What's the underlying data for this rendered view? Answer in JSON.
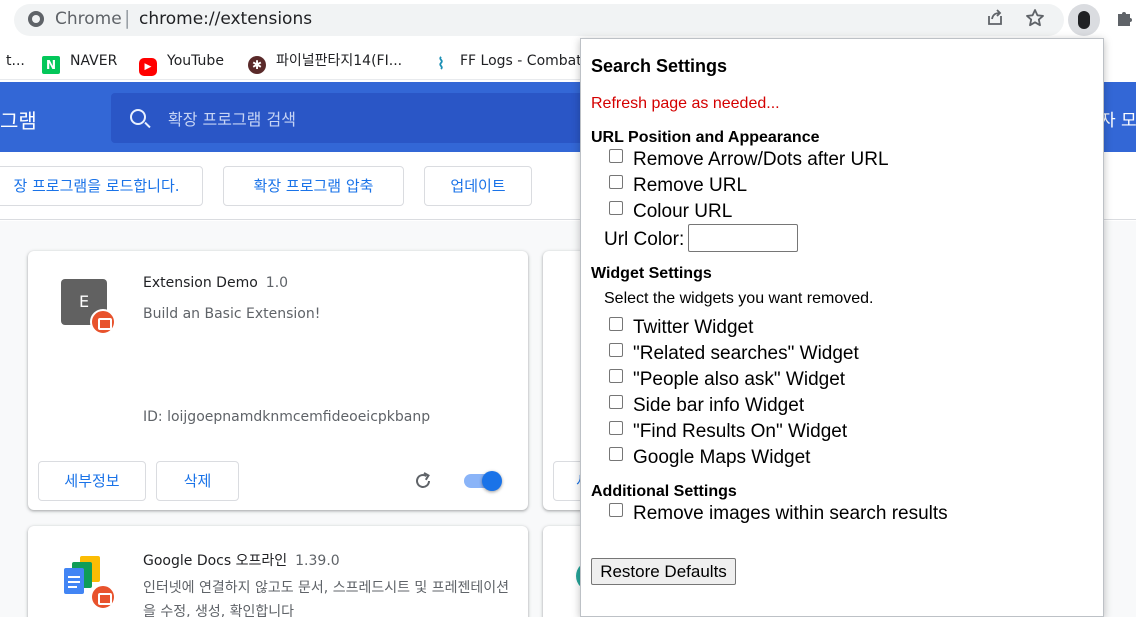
{
  "omnibox": {
    "site_label": "Chrome",
    "separator": "|",
    "url": "chrome://extensions"
  },
  "toolbar_icons": [
    "share-icon",
    "star-icon",
    "profile-icon",
    "puzzle-icon"
  ],
  "bookmarks": [
    {
      "label": "t...",
      "icon": "bookmark-favicon"
    },
    {
      "label": "NAVER",
      "icon": "naver-icon",
      "color": "#03c75a",
      "glyph": "N"
    },
    {
      "label": "YouTube",
      "icon": "youtube-icon",
      "color": "#ff0000",
      "glyph": "▶"
    },
    {
      "label": "파이널판타지14(FI...",
      "icon": "ff14-icon",
      "color": "#5a2a2a",
      "glyph": "✱"
    },
    {
      "label": "FF Logs - Combat",
      "icon": "fflogs-icon",
      "color": "#1a8fb5",
      "glyph": "⌇"
    }
  ],
  "header": {
    "title": "그램",
    "search_placeholder": "확장 프로그램 검색",
    "right_text": "자 모",
    "color": "#3367d6"
  },
  "dev_buttons": {
    "load_unpacked": "장 프로그램을 로드합니다.",
    "pack": "확장 프로그램 압축",
    "update": "업데이트"
  },
  "extensions": [
    {
      "icon_letter": "E",
      "name": "Extension Demo",
      "version": "1.0",
      "description": "Build an Basic Extension!",
      "id": "ID: loijgoepnamdknmcemfideoeicpkbanp",
      "details_label": "세부정보",
      "remove_label": "삭제",
      "enabled": true
    },
    {
      "name": "Google Docs 오프라인",
      "version": "1.39.0",
      "description": "인터넷에 연결하지 않고도 문서, 스프레드시트 및 프레젠테이션을 수정, 생성, 확인합니다"
    }
  ],
  "partial_card": {
    "button_fragment": "세"
  },
  "popup": {
    "title": "Search Settings",
    "status": "Refresh page as needed...",
    "url_section": {
      "heading": "URL Position and Appearance",
      "options": [
        "Remove Arrow/Dots after URL",
        "Remove URL",
        "Colour URL"
      ],
      "url_color_label": "Url Color:"
    },
    "widget_section": {
      "heading": "Widget Settings",
      "hint": "Select the widgets you want removed.",
      "options": [
        "Twitter Widget",
        "\"Related searches\" Widget",
        "\"People also ask\" Widget",
        "Side bar info Widget",
        "\"Find Results On\" Widget",
        "Google Maps Widget"
      ]
    },
    "additional_section": {
      "heading": "Additional Settings",
      "options": [
        "Remove images within search results"
      ]
    },
    "restore_label": "Restore Defaults"
  }
}
